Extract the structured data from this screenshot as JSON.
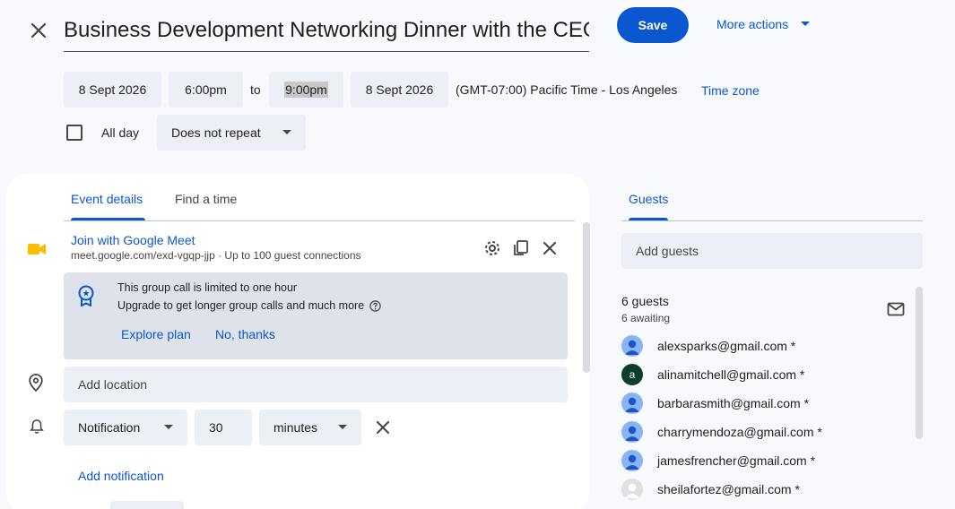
{
  "header": {
    "title": "Business Development Networking Dinner with the CEO",
    "save_label": "Save",
    "more_actions_label": "More actions"
  },
  "datetime": {
    "start_date": "8 Sept 2026",
    "start_time": "6:00pm",
    "to_label": "to",
    "end_time": "9:00pm",
    "end_date": "8 Sept 2026",
    "timezone_text": "(GMT-07:00) Pacific Time - Los Angeles",
    "timezone_link": "Time zone",
    "all_day_label": "All day",
    "all_day_checked": false,
    "repeat_value": "Does not repeat"
  },
  "tabs": [
    {
      "label": "Event details",
      "active": true
    },
    {
      "label": "Find a time",
      "active": false
    }
  ],
  "meet": {
    "title": "Join with Google Meet",
    "subtitle": "meet.google.com/exd-vgqp-jjp · Up to 100 guest connections"
  },
  "banner": {
    "title": "This group call is limited to one hour",
    "subtitle": "Upgrade to get longer group calls and much more",
    "explore_label": "Explore plan",
    "dismiss_label": "No, thanks"
  },
  "location": {
    "placeholder": "Add location"
  },
  "notification": {
    "type": "Notification",
    "amount": "30",
    "unit": "minutes",
    "add_label": "Add notification"
  },
  "guests_panel": {
    "tab_label": "Guests",
    "add_placeholder": "Add guests",
    "count_label": "6 guests",
    "awaiting_label": "6 awaiting",
    "list": [
      {
        "email": "alexsparks@gmail.com *",
        "avatar": "default"
      },
      {
        "email": "alinamitchell@gmail.com *",
        "avatar": "letter",
        "letter": "a"
      },
      {
        "email": "barbarasmith@gmail.com *",
        "avatar": "default"
      },
      {
        "email": "charrymendoza@gmail.com *",
        "avatar": "default"
      },
      {
        "email": "jamesfrencher@gmail.com *",
        "avatar": "default"
      },
      {
        "email": "sheilafortez@gmail.com *",
        "avatar": "grey"
      }
    ]
  },
  "colors": {
    "accent": "#0b57d0",
    "meet_icon": "#fbbc04",
    "avatar_blue": "#8ab4f8",
    "avatar_green": "#0d3e2b"
  }
}
